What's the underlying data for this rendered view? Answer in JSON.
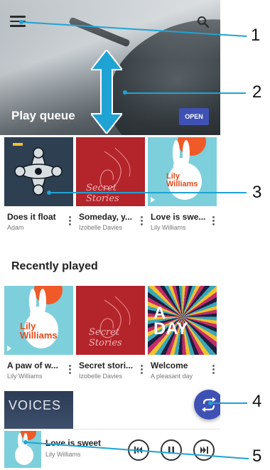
{
  "header": {
    "queue_title": "Play queue",
    "open_label": "OPEN",
    "menu_icon": "hamburger-menu-icon",
    "search_icon": "search-icon"
  },
  "queue_tiles": [
    {
      "title": "Does it float",
      "subtitle": "Adam",
      "art_text": ""
    },
    {
      "title": "Someday, y...",
      "subtitle": "Izobelle Davies",
      "art_text": "Secret Stories"
    },
    {
      "title": "Love is swe...",
      "subtitle": "Lily Williams",
      "art_text": "Lily Williams"
    }
  ],
  "recently_played": {
    "title": "Recently played",
    "tiles": [
      {
        "title": "A paw of w...",
        "subtitle": "Lily Williams",
        "art_text": "Lily Williams"
      },
      {
        "title": "Secret stori...",
        "subtitle": "Izobelle Davies",
        "art_text": "Secret Stories"
      },
      {
        "title": "Welcome",
        "subtitle": "A pleasant day",
        "art_text": "A DAY"
      }
    ],
    "partial_tile_text": "VOICES"
  },
  "fab_icon": "shuffle-icon",
  "now_playing": {
    "title": "Love is sweet",
    "artist": "Lily Williams"
  },
  "callouts": [
    "1",
    "2",
    "3",
    "4",
    "5"
  ],
  "colors": {
    "accent": "#3f51b5",
    "callout": "#1fa3d4"
  }
}
